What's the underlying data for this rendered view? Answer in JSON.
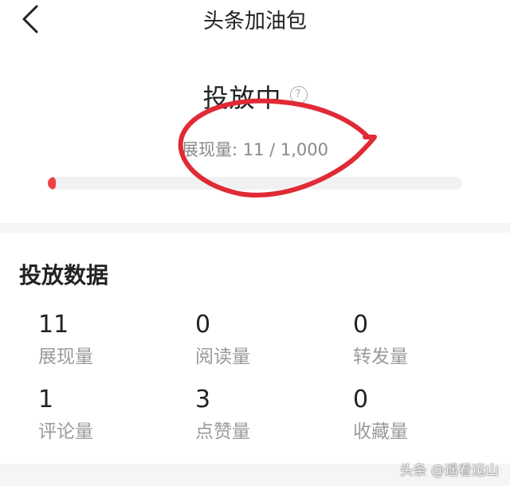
{
  "nav": {
    "back_icon": "chevron-left-icon",
    "title": "头条加油包"
  },
  "status": {
    "title": "投放中",
    "help_glyph": "?",
    "impressions_text": "展现量: 11 / 1,000",
    "progress_fraction": 0.011,
    "progress_color": "#f04142",
    "annotation_color": "#e02a35"
  },
  "data": {
    "title": "投放数据",
    "stats": [
      {
        "value": "11",
        "label": "展现量"
      },
      {
        "value": "0",
        "label": "阅读量"
      },
      {
        "value": "0",
        "label": "转发量"
      },
      {
        "value": "1",
        "label": "评论量"
      },
      {
        "value": "3",
        "label": "点赞量"
      },
      {
        "value": "0",
        "label": "收藏量"
      }
    ]
  },
  "watermark": "头条 @遥看远山"
}
